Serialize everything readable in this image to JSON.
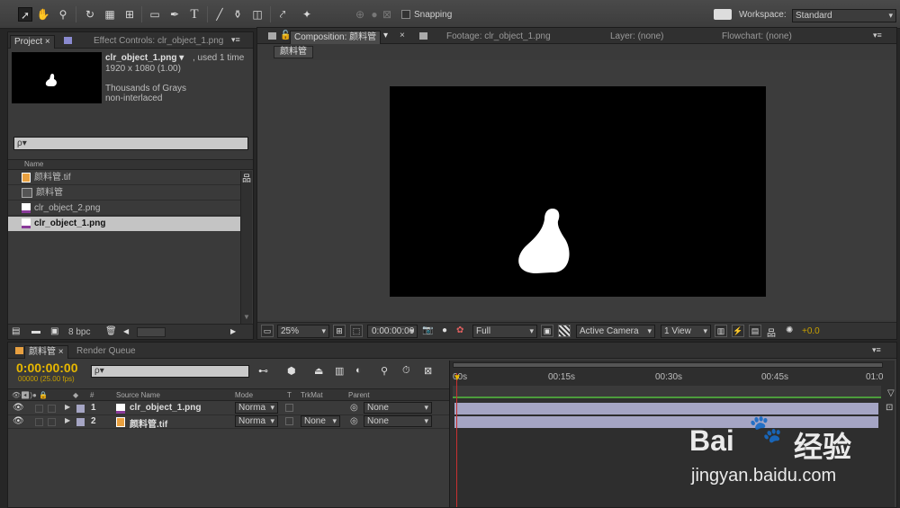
{
  "toolbar": {
    "snapping_label": "Snapping",
    "workspace_label": "Workspace:",
    "workspace_value": "Standard"
  },
  "project_panel": {
    "tabs": [
      "Project ×",
      "Effect Controls: clr_object_1.png"
    ],
    "preview": {
      "name": "clr_object_1.png ▾",
      "used": ", used 1 time",
      "dims": "1920 x 1080 (1.00)",
      "color": "Thousands of Grays",
      "interlace": "non-interlaced"
    },
    "search_placeholder": "ρ▾",
    "column_name": "Name",
    "items": [
      {
        "name": "颜料管.tif",
        "type": "tif",
        "selected": false
      },
      {
        "name": "颜料管",
        "type": "comp",
        "selected": false
      },
      {
        "name": "clr_object_2.png",
        "type": "png",
        "selected": false
      },
      {
        "name": "clr_object_1.png",
        "type": "png",
        "selected": true
      }
    ],
    "bpc": "8 bpc"
  },
  "comp_panel": {
    "tabs": [
      "Composition: 颜料管",
      "Footage: clr_object_1.png",
      "Layer: (none)",
      "Flowchart: (none)"
    ],
    "breadcrumb": "颜料管",
    "zoom": "25%",
    "timecode": "0:00:00:00",
    "resolution": "Full",
    "camera": "Active Camera",
    "views": "1 View",
    "exposure": "+0.0"
  },
  "timeline": {
    "tabs": [
      "颜料管 ×",
      "Render Queue"
    ],
    "timecode": "0:00:00:00",
    "fps": "00000 (25.00 fps)",
    "columns": {
      "source_name": "Source Name",
      "mode": "Mode",
      "t": "T",
      "trkmat": "TrkMat",
      "parent": "Parent"
    },
    "ruler": [
      "00s",
      "00:15s",
      "00:30s",
      "00:45s",
      "01:0"
    ],
    "layers": [
      {
        "num": "1",
        "name": "clr_object_1.png",
        "mode": "Norma",
        "trkmat": "",
        "parent": "None",
        "color": "#a5a5c4"
      },
      {
        "num": "2",
        "name": "颜料管.tif",
        "mode": "Norma",
        "trkmat": "None",
        "parent": "None",
        "color": "#a5a5c4"
      }
    ]
  },
  "watermark": {
    "brand": "Bai",
    "brand2": "经验",
    "url": "jingyan.baidu.com"
  }
}
